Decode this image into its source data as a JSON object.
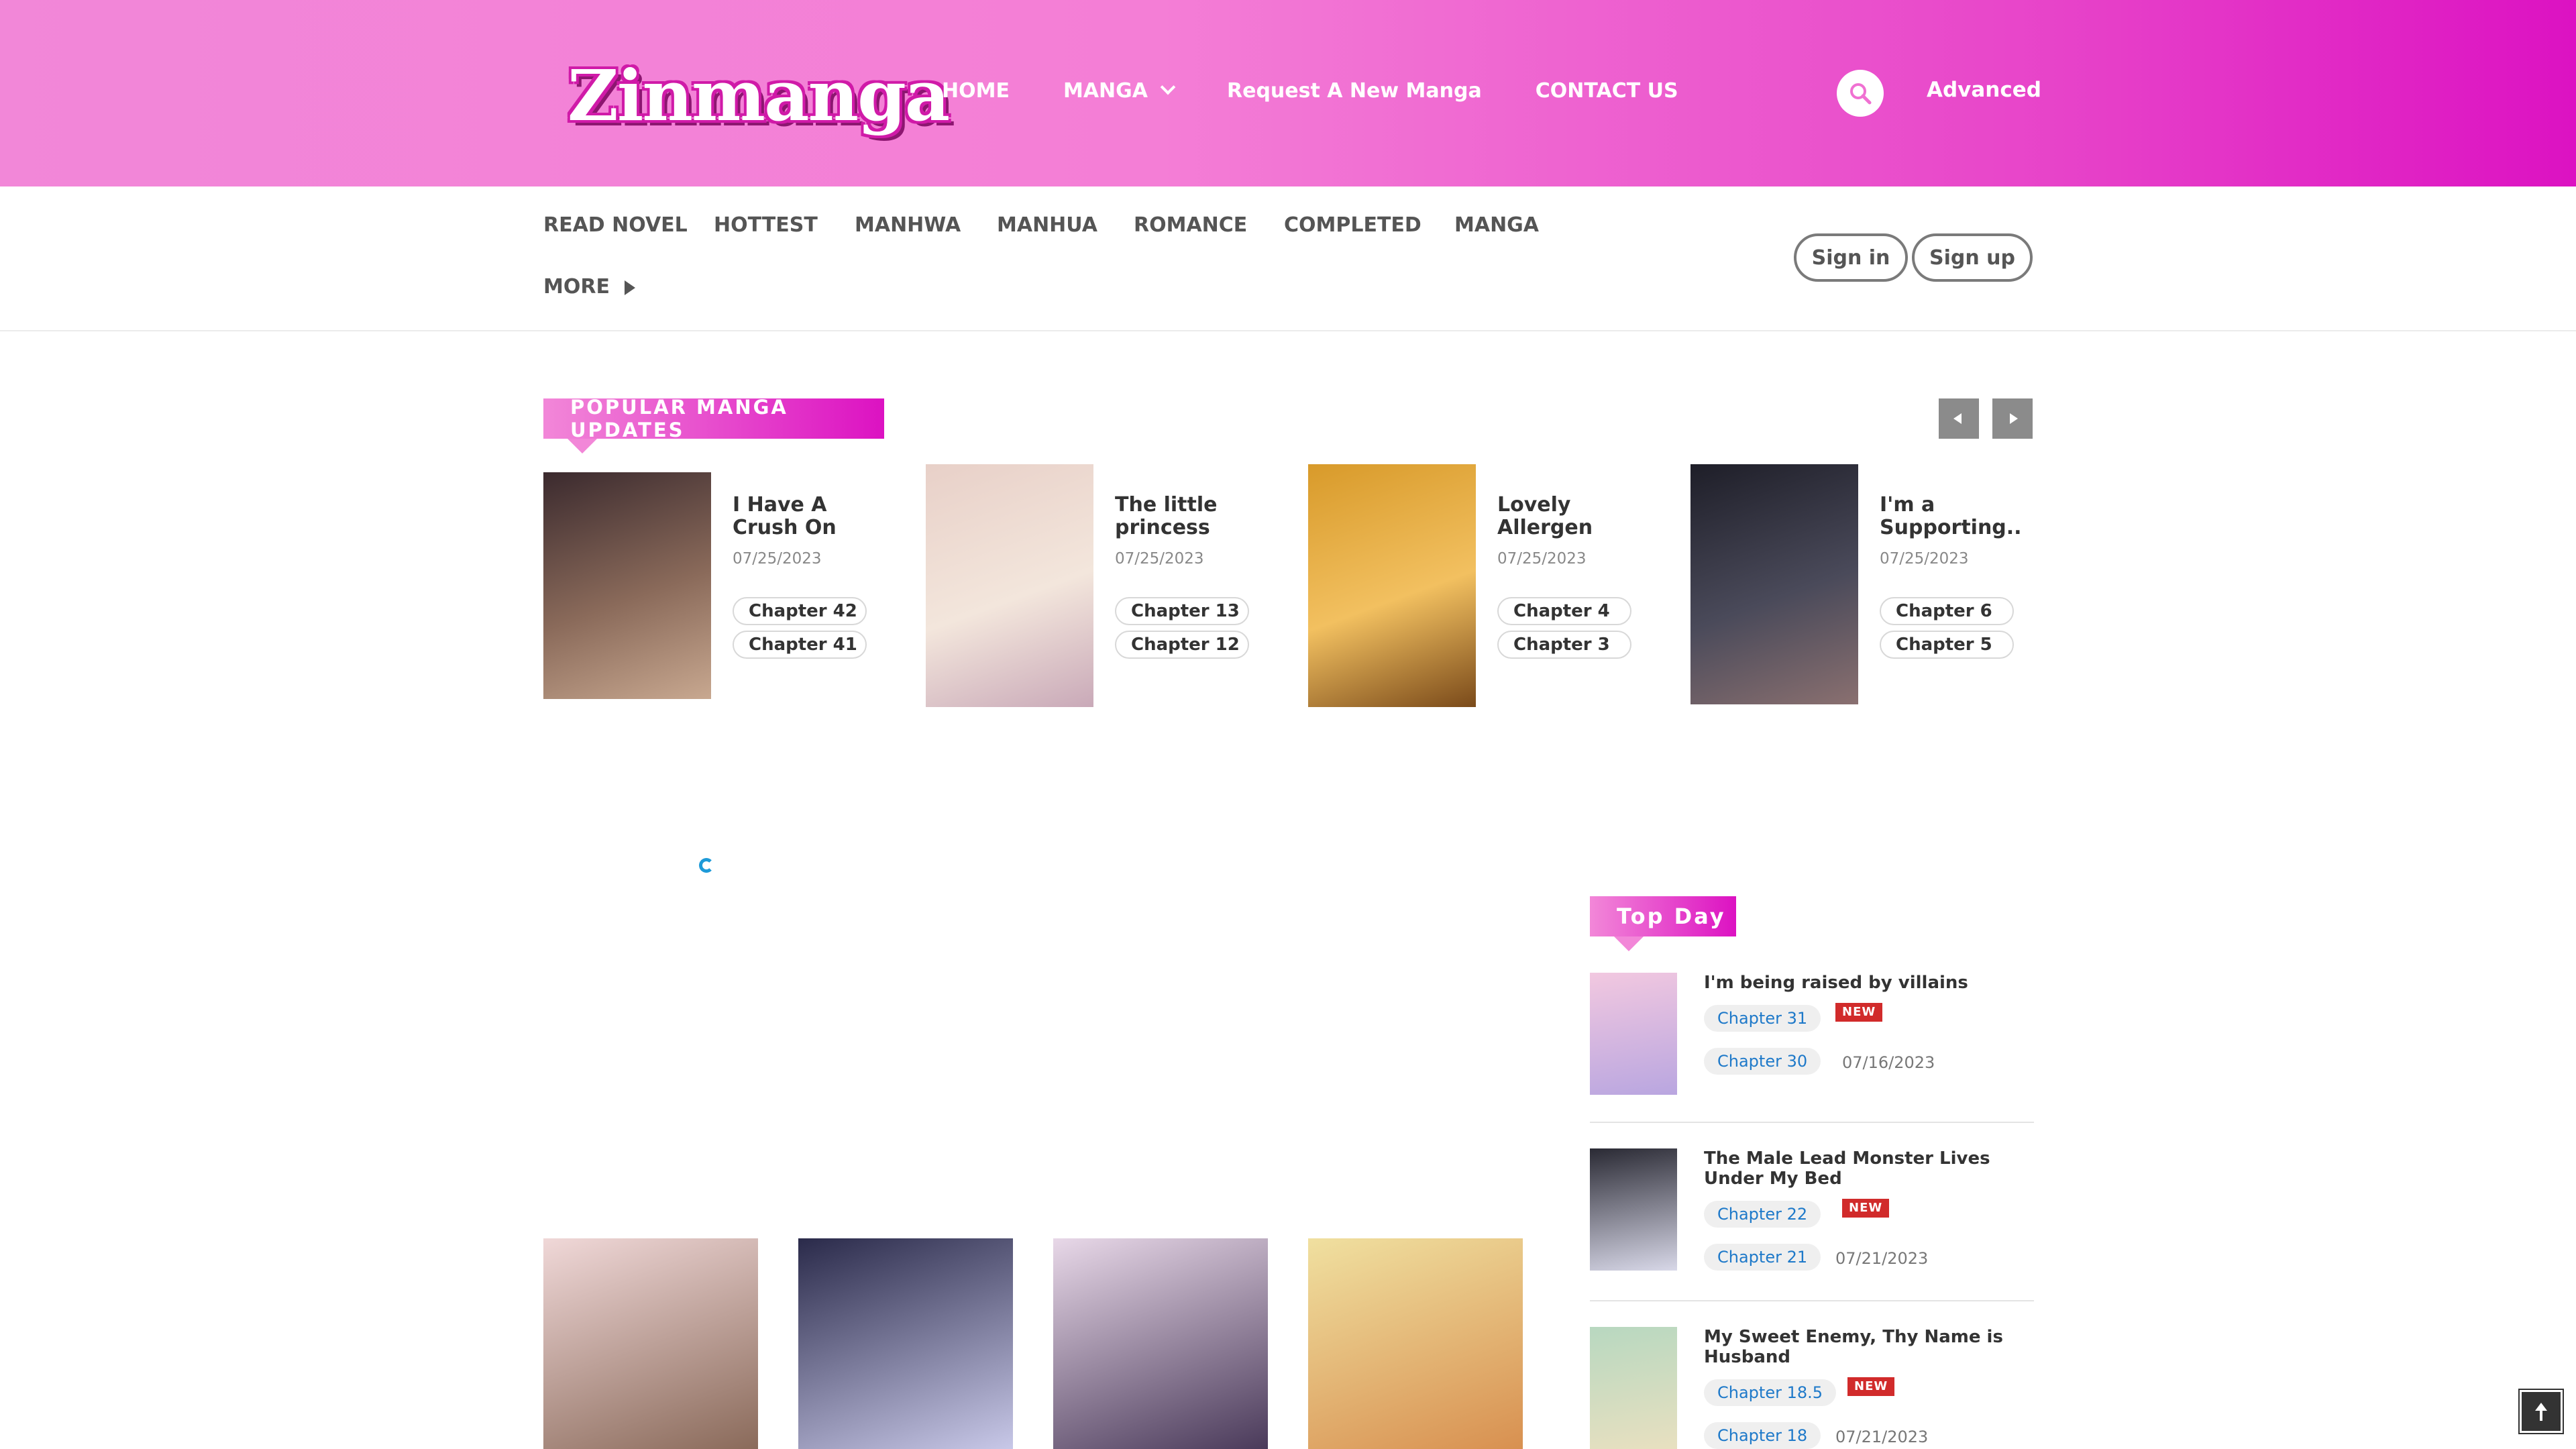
{
  "header": {
    "logo_text": "Zinmanga",
    "nav": [
      {
        "label": "HOME"
      },
      {
        "label": "MANGA"
      },
      {
        "label": "Request A New Manga"
      },
      {
        "label": "CONTACT US"
      }
    ],
    "advanced_label": "Advanced"
  },
  "subnav": {
    "items": [
      "READ NOVEL",
      "HOTTEST",
      "MANHWA",
      "MANHUA",
      "ROMANCE",
      "COMPLETED",
      "MANGA"
    ],
    "more_label": "MORE",
    "sign_in": "Sign in",
    "sign_up": "Sign up"
  },
  "popular": {
    "heading": "POPULAR MANGA UPDATES",
    "cards": [
      {
        "title": "I Have A Crush On A...",
        "date": "07/25/2023",
        "chapters": [
          "Chapter 42",
          "Chapter 41"
        ],
        "colors": [
          "#3b2a2e",
          "#8a6a5a",
          "#c8a890"
        ]
      },
      {
        "title": "The little princess",
        "date": "07/25/2023",
        "chapters": [
          "Chapter 13",
          "Chapter 12"
        ],
        "colors": [
          "#e8d0c8",
          "#f3e6dc",
          "#c9a9b8"
        ]
      },
      {
        "title": "Lovely Allergen",
        "date": "07/25/2023",
        "chapters": [
          "Chapter 4",
          "Chapter 3"
        ],
        "colors": [
          "#d89a2a",
          "#f2c060",
          "#7a4a1a"
        ]
      },
      {
        "title": "I'm a Supporting...",
        "date": "07/25/2023",
        "chapters": [
          "Chapter 6",
          "Chapter 5"
        ],
        "colors": [
          "#1e1e28",
          "#4a4a5a",
          "#8a7070"
        ]
      }
    ]
  },
  "top_day": {
    "heading": "Top Day",
    "new_label": "NEW",
    "items": [
      {
        "title": "I'm being raised by villains",
        "chapters": [
          "Chapter 31",
          "Chapter 30"
        ],
        "date": "07/16/2023",
        "colors": [
          "#f2c8e0",
          "#b9a6e0"
        ]
      },
      {
        "title": "The Male Lead Monster Lives Under My Bed",
        "chapters": [
          "Chapter 22",
          "Chapter 21"
        ],
        "date": "07/21/2023",
        "colors": [
          "#2a2a34",
          "#d8d8e8"
        ]
      },
      {
        "title": "My Sweet Enemy, Thy Name is Husband",
        "chapters": [
          "Chapter 18.5",
          "Chapter 18"
        ],
        "date": "07/21/2023",
        "colors": [
          "#b8d8c0",
          "#e8e0c0"
        ]
      }
    ]
  },
  "grid": [
    {
      "colors": [
        "#f0d8d8",
        "#8a6a5a"
      ]
    },
    {
      "colors": [
        "#2a2a4a",
        "#c8c8e8"
      ]
    },
    {
      "colors": [
        "#e8d8e8",
        "#4a3a5a"
      ]
    },
    {
      "colors": [
        "#f0e0a0",
        "#d89050"
      ]
    }
  ]
}
